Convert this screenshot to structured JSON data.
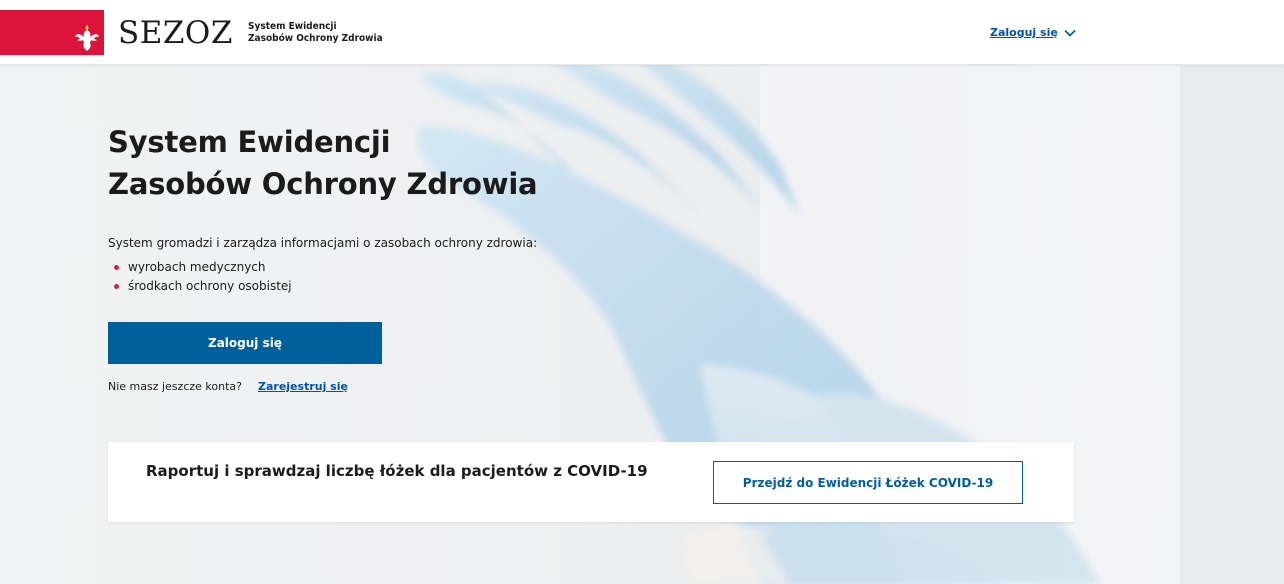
{
  "header": {
    "brand_name": "SEZOZ",
    "brand_sub_line1": "System Ewidencji",
    "brand_sub_line2": "Zasobów Ochrony Zdrowia",
    "login_menu_label": "Zaloguj się",
    "brand_color": "#dc143c"
  },
  "hero": {
    "title_line1": "System Ewidencji",
    "title_line2": "Zasobów Ochrony Zdrowia",
    "description": "System gromadzi i zarządza informacjami o zasobach ochrony zdrowia:",
    "bullets": [
      "wyrobach medycznych",
      "środkach ochrony osobistej"
    ],
    "login_button": "Zaloguj się",
    "no_account_text": "Nie masz jeszcze konta?",
    "register_link": "Zarejestruj się",
    "button_color": "#00609c"
  },
  "covid_card": {
    "text": "Raportuj i sprawdzaj liczbę łóżek dla pacjentów z COVID-19",
    "button": "Przejdź do Ewidencji Łóżek COVID-19"
  }
}
